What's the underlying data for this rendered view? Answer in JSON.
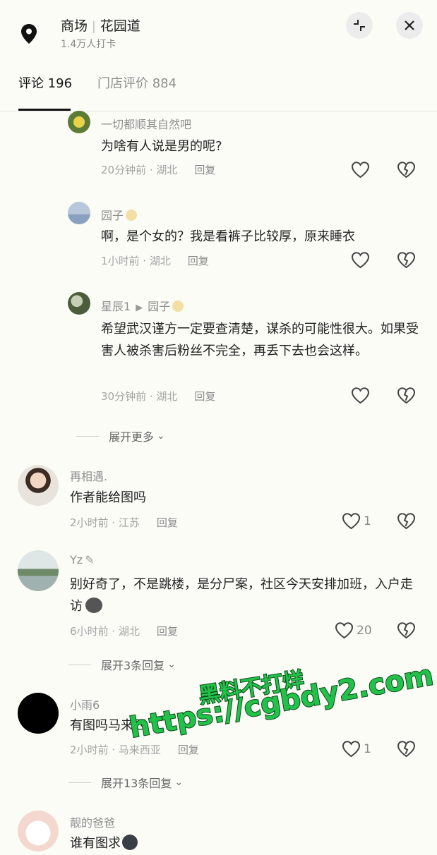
{
  "header": {
    "location_title": "商场",
    "location_name": "花园道",
    "checkins": "1.4万人打卡"
  },
  "tabs": [
    {
      "label": "评论 196"
    },
    {
      "label": "门店评价 884"
    }
  ],
  "comments": [
    {
      "name": "一切都顺其自然吧",
      "text": "为啥有人说是男的呢?",
      "time": "20分钟前 · 湖北",
      "reply": "回复",
      "likes": ""
    },
    {
      "name": "园子",
      "text": "啊，是个女的？我是看裤子比较厚，原来睡衣",
      "time": "1小时前 · 湖北",
      "reply": "回复",
      "likes": ""
    },
    {
      "name": "星辰1",
      "reply_to": "园子",
      "text": "希望武汉谨方一定要查清楚，谋杀的可能性很大。如果受害人被杀害后粉丝不完全，再丢下去也会这样。",
      "time": "30分钟前 · 湖北",
      "reply": "回复",
      "likes": ""
    },
    {
      "name": "再相遇.",
      "text": "作者能给图吗",
      "time": "2小时前 · 江苏",
      "reply": "回复",
      "likes": "1"
    },
    {
      "name": "Yz",
      "text": "别好奇了，不是跳楼，是分尸案，社区今天安排加班，入户走访",
      "time": "6小时前 · 湖北",
      "reply": "回复",
      "likes": "20"
    },
    {
      "name": "小雨6",
      "text": "有图吗马来西",
      "time": "2小时前 · 马来西亚",
      "reply": "回复",
      "likes": "1"
    },
    {
      "name": "靓的爸爸",
      "text": "谁有图求"
    }
  ],
  "expand": [
    {
      "label": "展开更多"
    },
    {
      "label": "展开3条回复"
    },
    {
      "label": "展开13条回复"
    }
  ],
  "watermark": {
    "line1": "黑料不打烊",
    "line2": "https://cgbdy2.com"
  },
  "icons": {
    "location": "location-pin-icon",
    "minimize": "minimize-icon",
    "close": "close-icon",
    "like": "heart-icon",
    "dislike": "broken-heart-icon"
  }
}
